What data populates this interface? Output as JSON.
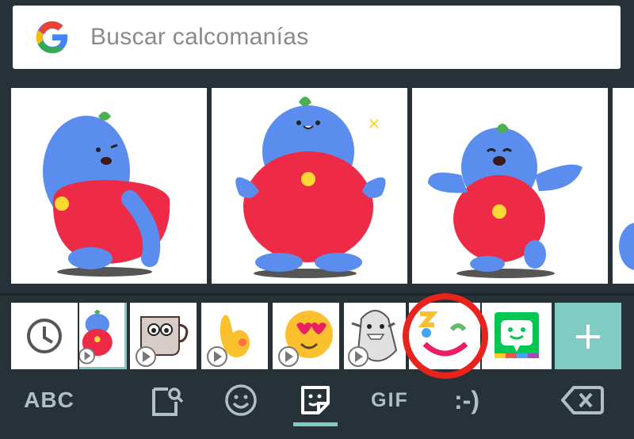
{
  "search": {
    "placeholder": "Buscar calcomanías",
    "logo": "google-g-logo"
  },
  "stickers": [
    {
      "name": "sticker-blob-winking",
      "icon": "blue-blob-character"
    },
    {
      "name": "sticker-blob-standing",
      "icon": "blue-blob-character"
    },
    {
      "name": "sticker-blob-waving",
      "icon": "blue-blob-character"
    }
  ],
  "packs": [
    {
      "name": "recent",
      "icon": "clock-icon"
    },
    {
      "name": "blob-pack",
      "icon": "blue-blob-thumbnail",
      "selected": true
    },
    {
      "name": "coffee-cup-pack",
      "icon": "coffee-cup-thumbnail",
      "animated": true
    },
    {
      "name": "yellow-hand-pack",
      "icon": "yellow-hand-thumbnail",
      "animated": true
    },
    {
      "name": "heart-eyes-pack",
      "icon": "heart-eyes-thumbnail",
      "animated": true
    },
    {
      "name": "shark-pack",
      "icon": "shark-thumbnail",
      "animated": true
    },
    {
      "name": "face-pack",
      "icon": "colorful-face-thumbnail",
      "highlighted": true
    },
    {
      "name": "bitmoji-pack",
      "icon": "bitmoji-thumbnail"
    },
    {
      "name": "add",
      "icon": "plus-icon",
      "label": "+"
    }
  ],
  "tabs": {
    "abc": "ABC",
    "gif": "GIF",
    "emoticon": ":-)"
  },
  "colors": {
    "background": "#263238",
    "accent": "#80cbc4",
    "blob": "#5b8def",
    "blob_body": "#ee2b47",
    "highlight_ring": "#e8231c"
  }
}
